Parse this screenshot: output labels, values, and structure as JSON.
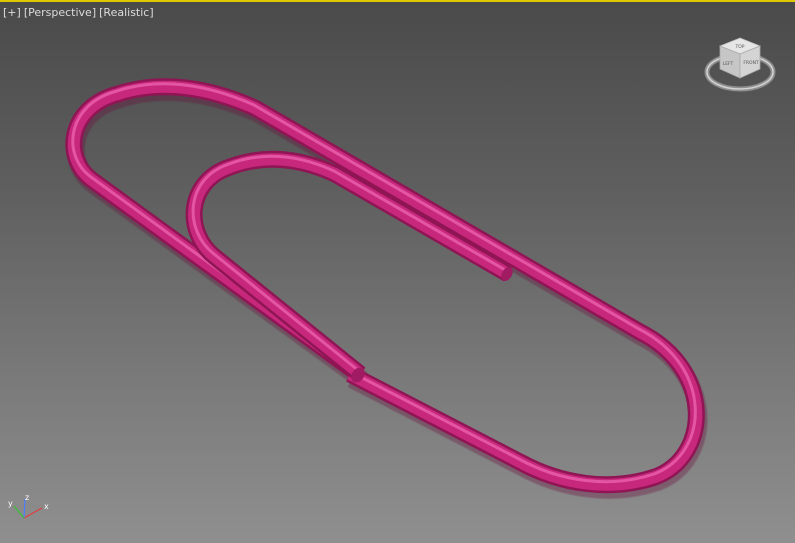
{
  "viewport": {
    "labels": [
      "+",
      "Perspective",
      "Realistic"
    ]
  },
  "viewcube": {
    "faces": [
      "TOP",
      "LEFT",
      "FRONT"
    ]
  },
  "axis_tripod": {
    "x": "x",
    "y": "y",
    "z": "z"
  },
  "colors": {
    "paperclip": "#c8287c",
    "paperclip_highlight": "#f06ab4",
    "paperclip_shadow": "#7a0f45",
    "active_border": "#e0c800"
  }
}
